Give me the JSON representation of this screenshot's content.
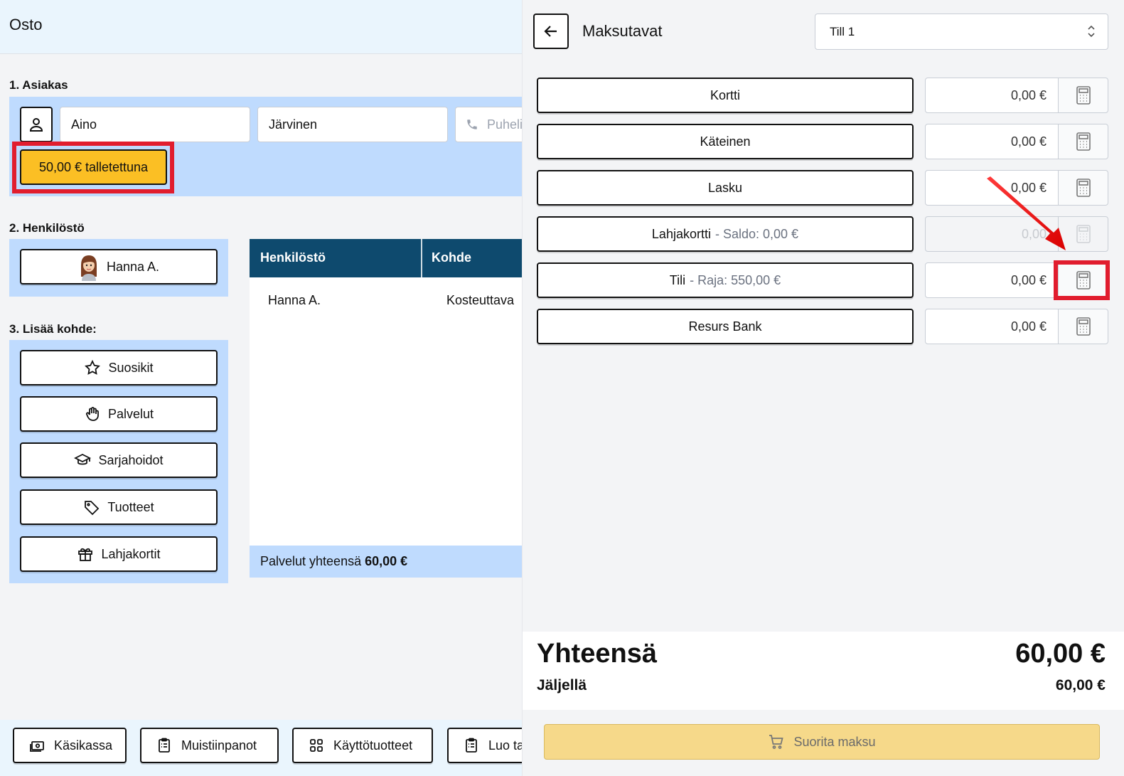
{
  "left": {
    "title": "Osto",
    "customer": {
      "section_label": "1. Asiakas",
      "first_name": "Aino",
      "last_name": "Järvinen",
      "phone_placeholder": "Puhelin",
      "deposit_label": "50,00 € talletettuna"
    },
    "staff": {
      "section_label": "2. Henkilöstö",
      "selected_staff": "Hanna A."
    },
    "add_target": {
      "section_label": "3. Lisää kohde:",
      "buttons": [
        {
          "label": "Suosikit",
          "icon": "star-icon"
        },
        {
          "label": "Palvelut",
          "icon": "hand-icon"
        },
        {
          "label": "Sarjahoidot",
          "icon": "graduation-cap-icon"
        },
        {
          "label": "Tuotteet",
          "icon": "tag-icon"
        },
        {
          "label": "Lahjakortit",
          "icon": "gift-icon"
        }
      ]
    },
    "table": {
      "headers": [
        "Henkilöstö",
        "Kohde"
      ],
      "rows": [
        [
          "Hanna A.",
          "Kosteuttava"
        ]
      ],
      "footer_label": "Palvelut yhteensä",
      "footer_value": "60,00 €"
    },
    "bottom_bar": [
      {
        "label": "Käsikassa",
        "icon": "cash-icon"
      },
      {
        "label": "Muistiinpanot",
        "icon": "clipboard-icon"
      },
      {
        "label": "Käyttötuotteet",
        "icon": "grid-icon"
      },
      {
        "label": "Luo ta",
        "icon": "clipboard-icon"
      }
    ]
  },
  "right": {
    "title": "Maksutavat",
    "till_select": "Till 1",
    "methods": [
      {
        "label": "Kortti",
        "sub": "",
        "amount": "0,00 €",
        "disabled": false
      },
      {
        "label": "Käteinen",
        "sub": "",
        "amount": "0,00 €",
        "disabled": false
      },
      {
        "label": "Lasku",
        "sub": "",
        "amount": "0,00 €",
        "disabled": false
      },
      {
        "label": "Lahjakortti",
        "sub": "- Saldo: 0,00 €",
        "amount": "0,00",
        "disabled": true
      },
      {
        "label": "Tili",
        "sub": "- Raja: 550,00 €",
        "amount": "0,00 €",
        "disabled": false
      },
      {
        "label": "Resurs Bank",
        "sub": "",
        "amount": "0,00 €",
        "disabled": false
      }
    ],
    "total_label": "Yhteensä",
    "total_value": "60,00 €",
    "remaining_label": "Jäljellä",
    "remaining_value": "60,00 €",
    "submit_label": "Suorita maksu"
  },
  "colors": {
    "highlight": "#e11d2e",
    "deposit_button": "#fbbf24",
    "table_header": "#0e4a6e",
    "section_bg": "#bfdbfe",
    "submit_disabled": "#f6d98a"
  }
}
